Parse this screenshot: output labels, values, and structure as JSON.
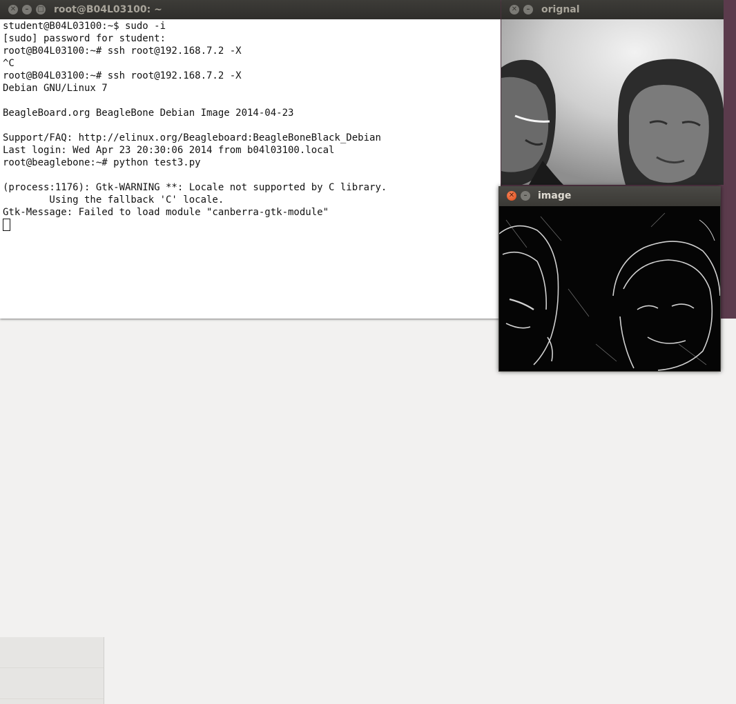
{
  "terminal": {
    "title": "root@B04L03100: ~",
    "lines": [
      "student@B04L03100:~$ sudo -i",
      "[sudo] password for student:",
      "root@B04L03100:~# ssh root@192.168.7.2 -X",
      "^C",
      "root@B04L03100:~# ssh root@192.168.7.2 -X",
      "Debian GNU/Linux 7",
      "",
      "BeagleBoard.org BeagleBone Debian Image 2014-04-23",
      "",
      "Support/FAQ: http://elinux.org/Beagleboard:BeagleBoneBlack_Debian",
      "Last login: Wed Apr 23 20:30:06 2014 from b04l03100.local",
      "root@beaglebone:~# python test3.py",
      "",
      "(process:1176): Gtk-WARNING **: Locale not supported by C library.",
      "        Using the fallback 'C' locale.",
      "Gtk-Message: Failed to load module \"canberra-gtk-module\""
    ]
  },
  "original_window": {
    "title": "orignal"
  },
  "image_window": {
    "title": "image"
  },
  "colors": {
    "titlebar_active": "#3b3a36",
    "close_active": "#df4a16",
    "terminal_bg": "#ffffff",
    "terminal_text": "#111111"
  },
  "icons": {
    "close": "close-icon",
    "minimize": "minimize-icon",
    "maximize": "maximize-icon"
  }
}
